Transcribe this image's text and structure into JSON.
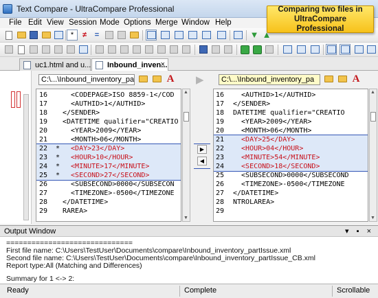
{
  "window": {
    "title": "Text Compare - UltraCompare Professional"
  },
  "callout": {
    "text": "Comparing two files in UltraCompare Professional"
  },
  "menu": [
    "File",
    "Edit",
    "View",
    "Session",
    "Mode",
    "Options",
    "Merge",
    "Window",
    "Help"
  ],
  "toolbar": {
    "compare_mode_star": "*",
    "not_equal": "≠",
    "equal": "="
  },
  "tabs": [
    {
      "label": "uc1.html and u...",
      "active": false
    },
    {
      "label": "Inbound_inven...",
      "active": true,
      "close": "×"
    }
  ],
  "left_pane": {
    "path": "C:\\...\\Inbound_inventory_pa",
    "font_button": "A",
    "lines": [
      {
        "num": "16",
        "mark": "",
        "text": "  <CODEPAGE>ISO 8859-1</COD",
        "diff": false
      },
      {
        "num": "17",
        "mark": "",
        "text": "  <AUTHID>1</AUTHID>",
        "diff": false
      },
      {
        "num": "18",
        "mark": "",
        "text": "</SENDER>",
        "diff": false
      },
      {
        "num": "19",
        "mark": "",
        "text": "<DATETIME qualifier=\"CREATIO",
        "diff": false
      },
      {
        "num": "20",
        "mark": "",
        "text": "  <YEAR>2009</YEAR>",
        "diff": false
      },
      {
        "num": "21",
        "mark": "",
        "text": "  <MONTH>06</MONTH>",
        "diff": false
      },
      {
        "num": "22",
        "mark": "*",
        "text": "  <DAY>23</DAY>",
        "diff": true
      },
      {
        "num": "23",
        "mark": "*",
        "text": "  <HOUR>10</HOUR>",
        "diff": true
      },
      {
        "num": "24",
        "mark": "*",
        "text": "  <MINUTE>17</MINUTE>",
        "diff": true
      },
      {
        "num": "25",
        "mark": "*",
        "text": "  <SECOND>27</SECOND>",
        "diff": true
      },
      {
        "num": "26",
        "mark": "",
        "text": "  <SUBSECOND>0000</SUBSECON",
        "diff": false
      },
      {
        "num": "27",
        "mark": "",
        "text": "  <TIMEZONE>-0500</TIMEZONE",
        "diff": false
      },
      {
        "num": "28",
        "mark": "",
        "text": "</DATETIME>",
        "diff": false
      },
      {
        "num": "29",
        "mark": "",
        "text": "RAREA>",
        "diff": false
      }
    ]
  },
  "right_pane": {
    "path": "C:\\...\\Inbound_inventory_pa",
    "font_button": "A",
    "lines": [
      {
        "num": "16",
        "text": "  <AUTHID>1</AUTHID>",
        "diff": false
      },
      {
        "num": "17",
        "text": "</SENDER>",
        "diff": false
      },
      {
        "num": "18",
        "text": "DATETIME qualifier=\"CREATIO",
        "diff": false
      },
      {
        "num": "19",
        "text": "  <YEAR>2009</YEAR>",
        "diff": false
      },
      {
        "num": "20",
        "text": "  <MONTH>06</MONTH>",
        "diff": false
      },
      {
        "num": "21",
        "text": "  <DAY>25</DAY>",
        "diff": true
      },
      {
        "num": "22",
        "text": "  <HOUR>04</HOUR>",
        "diff": true
      },
      {
        "num": "23",
        "text": "  <MINUTE>54</MINUTE>",
        "diff": true
      },
      {
        "num": "24",
        "text": "  <SECOND>18</SECOND>",
        "diff": true
      },
      {
        "num": "25",
        "text": "  <SUBSECOND>0000</SUBSECOND",
        "diff": false
      },
      {
        "num": "26",
        "text": "  <TIMEZONE>-0500</TIMEZONE",
        "diff": false
      },
      {
        "num": "27",
        "text": "</DATETIME>",
        "diff": false
      },
      {
        "num": "28",
        "text": "NTROLAREA>",
        "diff": false
      },
      {
        "num": "29",
        "text": "",
        "diff": false
      }
    ]
  },
  "output": {
    "title": "Output Window",
    "controls": "▾ ▪ ×",
    "lines": [
      "==============================",
      "First file name: C:\\Users\\TestUser\\Documents\\compare\\Inbound_inventory_partIssue.xml",
      "Second file name: C:\\Users\\TestUser\\Documents\\compare\\Inbound_inventory_partIssue_CB.xml",
      "Report type:All (Matching and Differences)",
      "",
      "Summary for 1 <-> 2:"
    ]
  },
  "status": {
    "left": "Ready",
    "middle": "Complete",
    "right": "Scrollable"
  },
  "colors": {
    "diff_background": "#dde8f8",
    "diff_text": "#c8101a",
    "diff_border": "#3155b5",
    "callout": "#f7c21a"
  }
}
